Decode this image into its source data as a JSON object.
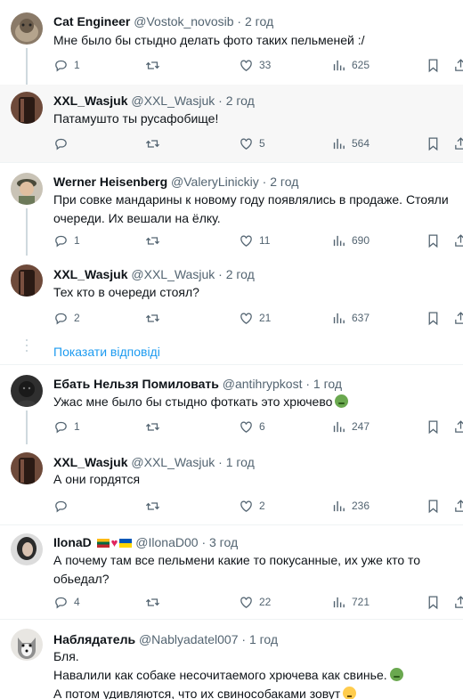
{
  "icons": {
    "reply": "reply-icon",
    "retweet": "retweet-icon",
    "like": "heart-icon",
    "views": "views-icon",
    "bookmark": "bookmark-icon",
    "share": "share-icon"
  },
  "tweets": [
    {
      "name": "Cat Engineer",
      "handle": "@Vostok_novosib",
      "time": "2 год",
      "lines": [
        "Мне было бы стыдно делать фото таких пельменей :/"
      ],
      "replies": "1",
      "retweets": "",
      "likes": "33",
      "views": "625"
    },
    {
      "name": "XXL_Wasjuk",
      "handle": "@XXL_Wasjuk",
      "time": "2 год",
      "lines": [
        "Патамушто ты русафобище!"
      ],
      "replies": "",
      "retweets": "",
      "likes": "5",
      "views": "564"
    },
    {
      "name": "Werner Heisenberg",
      "handle": "@ValeryLinickiy",
      "time": "2 год",
      "lines": [
        "При совке мандарины к новому году появлялись в продаже. Стояли",
        "очереди. Их вешали на ёлку."
      ],
      "replies": "1",
      "retweets": "",
      "likes": "11",
      "views": "690"
    },
    {
      "name": "XXL_Wasjuk",
      "handle": "@XXL_Wasjuk",
      "time": "2 год",
      "lines": [
        "Тех кто в очереди стоял?"
      ],
      "replies": "2",
      "retweets": "",
      "likes": "21",
      "views": "637"
    },
    {
      "name": "Ебать Нельзя Помиловать",
      "handle": "@antihrypkost",
      "time": "1 год",
      "lines": [
        "Ужас мне было бы стыдно фоткать это хрючево"
      ],
      "replies": "1",
      "retweets": "",
      "likes": "6",
      "views": "247"
    },
    {
      "name": "XXL_Wasjuk",
      "handle": "@XXL_Wasjuk",
      "time": "1 год",
      "lines": [
        "А они гордятся"
      ],
      "replies": "",
      "retweets": "",
      "likes": "2",
      "views": "236"
    },
    {
      "name": "IlonaD",
      "handle": "@IlonaD00",
      "time": "3 год",
      "lines": [
        "А почему там все пельмени какие то покусанные, их уже кто то",
        "обьедал?"
      ],
      "replies": "4",
      "retweets": "",
      "likes": "22",
      "views": "721"
    },
    {
      "name": "Наблядатель",
      "handle": "@Nablyadatel007",
      "time": "1 год",
      "lines": [
        "Бля.",
        "Навалили как собаке несочитаемого хрючева как свинье.",
        "А потом удивляются, что их свинособаками зовут"
      ]
    }
  ],
  "show_replies": "Показати відповіді",
  "dot": "·"
}
